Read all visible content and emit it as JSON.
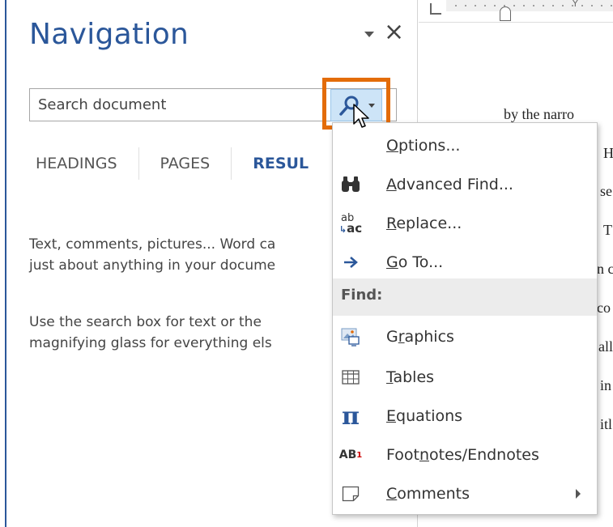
{
  "pane": {
    "title": "Navigation",
    "search_placeholder": "Search document",
    "tabs": [
      "HEADINGS",
      "PAGES",
      "RESULTS"
    ],
    "tab_results_visible": "RESUL",
    "help_line1": "Text, comments, pictures... Word ca",
    "help_line2": "just about anything in your docume",
    "help_line3": "Use the search box for text or the",
    "help_line4": "magnifying glass for everything els"
  },
  "menu": {
    "items": [
      {
        "pre": "",
        "accel": "O",
        "post": "ptions...",
        "icon": "none"
      },
      {
        "pre": "",
        "accel": "A",
        "post": "dvanced Find...",
        "icon": "binoculars-icon"
      },
      {
        "pre": "",
        "accel": "R",
        "post": "eplace...",
        "icon": "replace-icon"
      },
      {
        "pre": "",
        "accel": "G",
        "post": "o To...",
        "icon": "arrow-right-icon"
      }
    ],
    "find_header": "Find:",
    "find_items": [
      {
        "pre": "G",
        "accel": "r",
        "post": "aphics",
        "icon": "graphics-icon"
      },
      {
        "pre": "",
        "accel": "T",
        "post": "ables",
        "icon": "table-icon"
      },
      {
        "pre": "",
        "accel": "E",
        "post": "quations",
        "icon": "pi-icon"
      },
      {
        "pre": "Foot",
        "accel": "n",
        "post": "otes/Endnotes",
        "icon": "footnote-icon"
      },
      {
        "pre": "",
        "accel": "C",
        "post": "omments",
        "icon": "comment-icon"
      }
    ],
    "replace_icon_text": {
      "top": "ab",
      "bottom": "ac"
    },
    "footnote_icon_text": {
      "main": "AB",
      "sup": "1"
    },
    "pi_symbol": "π"
  },
  "document": {
    "lines": [
      "by the narro",
      "H",
      "se",
      "T",
      "n c",
      "co",
      "all",
      "in",
      "itl"
    ]
  },
  "ruler": {
    "mark": "Y"
  },
  "colors": {
    "accent": "#2b579a",
    "highlight": "#e36c09",
    "search_button_bg": "#cde4f7"
  }
}
